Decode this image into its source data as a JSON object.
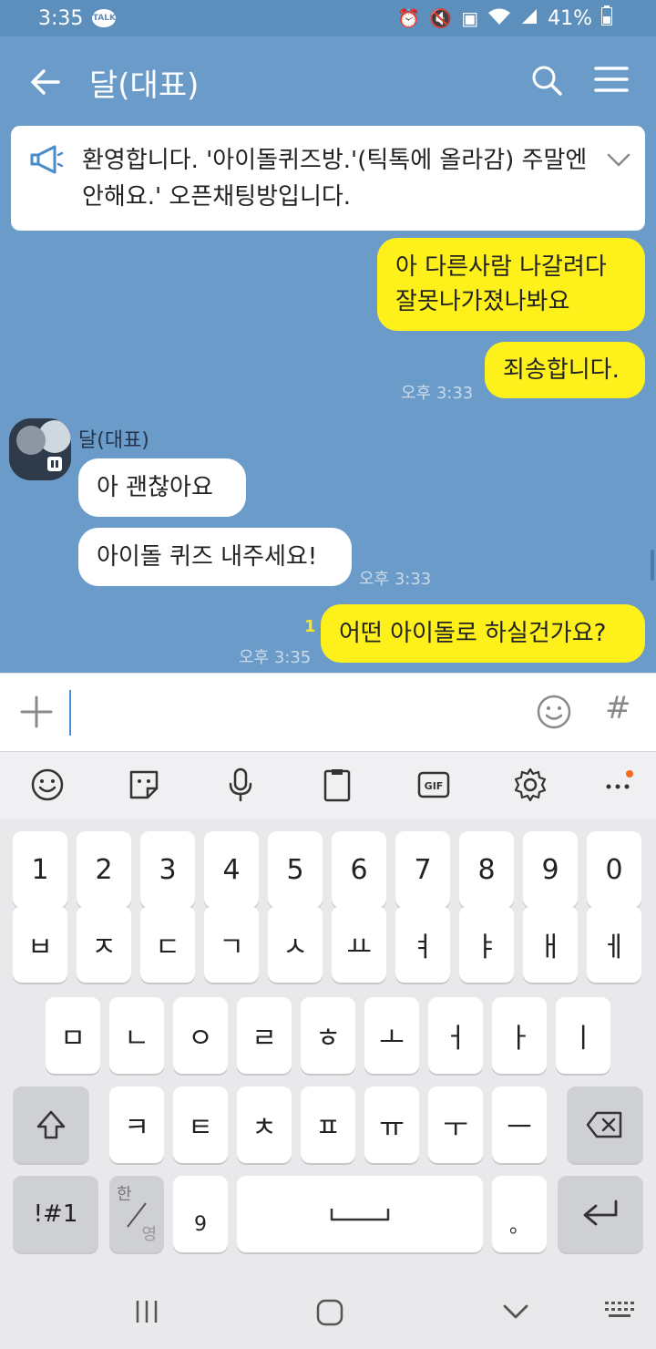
{
  "status": {
    "time": "3:35",
    "talk_badge": "TALK",
    "battery": "41%",
    "icons": [
      "alarm-icon",
      "mute-icon",
      "battery-saver-icon",
      "wifi-icon",
      "signal-icon",
      "battery-icon"
    ]
  },
  "header": {
    "title": "달(대표)",
    "back_icon": "back-arrow-icon",
    "search_icon": "search-icon",
    "menu_icon": "menu-icon"
  },
  "notice": {
    "icon": "megaphone-icon",
    "text": "환영합니다. '아이돌퀴즈방.'(틱톡에 올라감) 주말엔 안해요.' 오픈채팅방입니다."
  },
  "messages": {
    "m1": "아 다른사람 나갈려다 잘못나가졌나봐요",
    "m2": "죄송합니다.",
    "m2_time": "오후 3:33",
    "sender_name": "달(대표)",
    "m3": "아 괜찮아요",
    "m4": "아이돌 퀴즈 내주세요!",
    "m4_time": "오후 3:33",
    "m5": "어떤 아이돌로 하실건가요?",
    "m5_time": "오후 3:35",
    "m5_unread": "1"
  },
  "inputbar": {
    "plus_icon": "plus-icon",
    "emoji_icon": "emoji-icon",
    "hash": "#"
  },
  "keyboard_tools": [
    "emoji-icon",
    "sticker-icon",
    "microphone-icon",
    "clipboard-icon",
    "gif-icon",
    "settings-icon",
    "more-icon"
  ],
  "keyboard": {
    "row_numbers": [
      "1",
      "2",
      "3",
      "4",
      "5",
      "6",
      "7",
      "8",
      "9",
      "0"
    ],
    "row1": [
      "ㅂ",
      "ㅈ",
      "ㄷ",
      "ㄱ",
      "ㅅ",
      "ㅛ",
      "ㅕ",
      "ㅑ",
      "ㅐ",
      "ㅔ"
    ],
    "row2": [
      "ㅁ",
      "ㄴ",
      "ㅇ",
      "ㄹ",
      "ㅎ",
      "ㅗ",
      "ㅓ",
      "ㅏ",
      "ㅣ"
    ],
    "row3": [
      "ㅋ",
      "ㅌ",
      "ㅊ",
      "ㅍ",
      "ㅠ",
      "ㅜ",
      "ㅡ"
    ],
    "symbols": "!#1",
    "lang_top": "한",
    "lang_bottom": "영",
    "comma": "9",
    "period": "。"
  },
  "nav": [
    "recent-apps-icon",
    "home-icon",
    "back-icon",
    "keyboard-hide-icon"
  ]
}
